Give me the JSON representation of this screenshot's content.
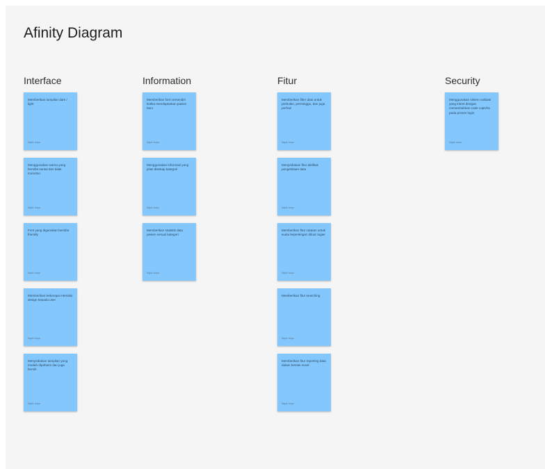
{
  "title": "Afinity Diagram",
  "columns": [
    {
      "heading": "Interface",
      "notes": [
        {
          "text": "Memberikan tampilan dark / light",
          "author": "Najah Izaya"
        },
        {
          "text": "Menggunakan warna yang bersifat santai dan tidak monoton",
          "author": "Najah Izaya"
        },
        {
          "text": "Font yang digunakan bersifat friendly",
          "author": "Najah Izaya"
        },
        {
          "text": "Memberikan beberapa interaksi design kepada user",
          "author": "Najah Izaya"
        },
        {
          "text": "Menyediakan tampilan yang mudah dipahami dan juga bersih",
          "author": "Najah Izaya"
        }
      ]
    },
    {
      "heading": "Information",
      "notes": [
        {
          "text": "Memberikan form tersendiri ketika mendaptarkan pasien baru",
          "author": "Najah Izaya"
        },
        {
          "text": "Menggunakan informasi yang jelas disetiap kategori",
          "author": "Najah Izaya"
        },
        {
          "text": "Memberikan statistik data pasien sesuai kategori",
          "author": "Najah Izaya"
        }
      ]
    },
    {
      "heading": "Fitur",
      "notes": [
        {
          "text": "Memberikan filter data untuk perbulan, perminggu, dan juga perhari",
          "author": "Najah Izaya"
        },
        {
          "text": "Menyediakan fitur aktifitas pengelolaan data",
          "author": "Najah Izaya"
        },
        {
          "text": "Memberikan fitur catatan untuk suatu kepentingan diluar tugas",
          "author": "Najah Izaya"
        },
        {
          "text": "Memberikan fitur searching",
          "author": "Najah Izaya"
        },
        {
          "text": "Memberikan fitur reporting data dalam bentuk excel",
          "author": "Najah Izaya"
        }
      ]
    },
    {
      "heading": "Security",
      "notes": [
        {
          "text": "Menggunakan sistem validasi yang intent dengan menambahkan code captcha pada proses login",
          "author": "Najah Izaya"
        }
      ]
    }
  ],
  "colors": {
    "note": "#83c7fd",
    "board": "#f5f5f5"
  }
}
